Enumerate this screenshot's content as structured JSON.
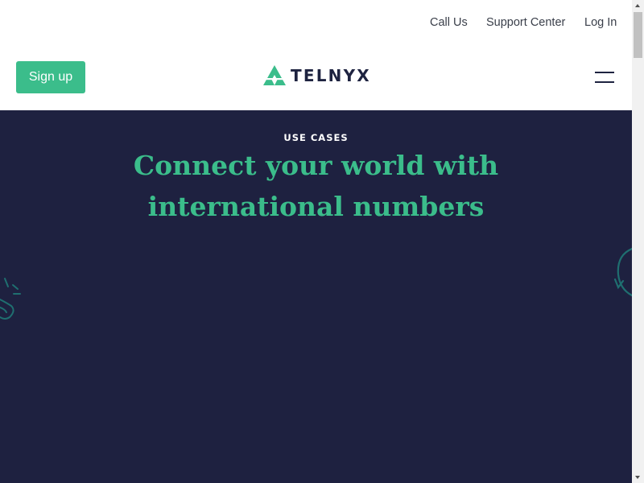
{
  "top_links": {
    "call_us": "Call Us",
    "support_center": "Support Center",
    "log_in": "Log In"
  },
  "nav": {
    "signup_label": "Sign up",
    "logo_text": "TELNYX",
    "menu_icon": "hamburger-menu-icon"
  },
  "hero": {
    "eyebrow": "USE CASES",
    "headline": "Connect your world with international numbers"
  },
  "colors": {
    "brand_green": "#3bbd8b",
    "hero_background": "#1e2140",
    "logo_dark": "#1e2340",
    "decoration_teal": "#1f6f70"
  }
}
